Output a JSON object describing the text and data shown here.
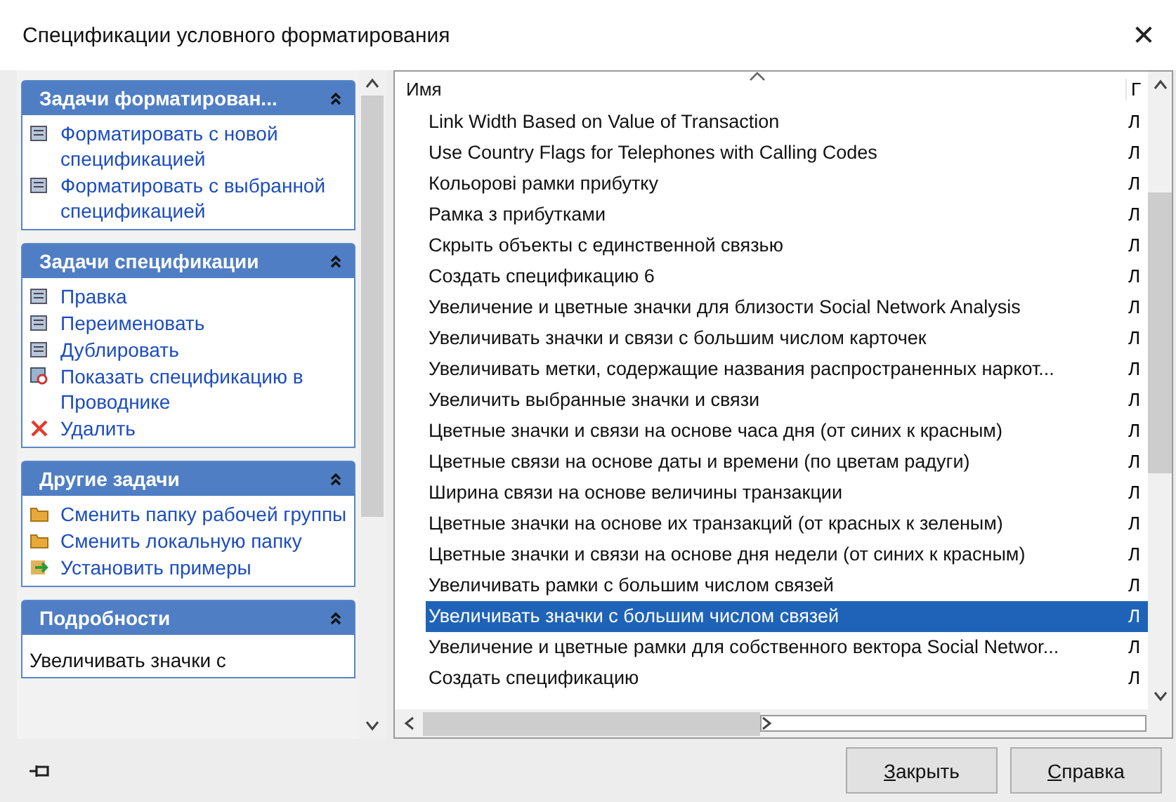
{
  "window": {
    "title": "Спецификации условного форматирования",
    "close": "✕"
  },
  "task_panes": [
    {
      "title": "Задачи форматирован...",
      "expanded": true,
      "items": [
        {
          "label": "Форматировать с новой спецификацией"
        },
        {
          "label": "Форматировать с выбранной спецификацией"
        }
      ]
    },
    {
      "title": "Задачи спецификации",
      "expanded": true,
      "items": [
        {
          "label": "Правка"
        },
        {
          "label": "Переименовать"
        },
        {
          "label": "Дублировать"
        },
        {
          "label": "Показать спецификацию в Проводнике"
        },
        {
          "label": "Удалить"
        }
      ]
    },
    {
      "title": "Другие задачи",
      "expanded": true,
      "items": [
        {
          "label": "Сменить папку рабочей группы"
        },
        {
          "label": "Сменить локальную папку"
        },
        {
          "label": "Установить примеры"
        }
      ]
    },
    {
      "title": "Подробности",
      "expanded": true,
      "text": "Увеличивать значки с"
    }
  ],
  "table": {
    "columns": [
      "Имя",
      "Г"
    ],
    "rows": [
      {
        "name": "Link Width Based on Value of Transaction",
        "column_2": "Л",
        "selected": false
      },
      {
        "name": "Use Country Flags for Telephones with Calling Codes",
        "column_2": "Л",
        "selected": false
      },
      {
        "name": "Кольорові рамки прибутку",
        "column_2": "Л",
        "selected": false
      },
      {
        "name": "Рамка з прибутками",
        "column_2": "Л",
        "selected": false
      },
      {
        "name": "Скрыть объекты с единственной связью",
        "column_2": "Л",
        "selected": false
      },
      {
        "name": "Создать спецификацию 6",
        "column_2": "Л",
        "selected": false
      },
      {
        "name": "Увеличение и цветные значки для близости Social Network Analysis",
        "column_2": "Л",
        "selected": false
      },
      {
        "name": "Увеличивать значки и связи с большим числом карточек",
        "column_2": "Л",
        "selected": false
      },
      {
        "name": "Увеличивать метки, содержащие названия распространенных наркот...",
        "column_2": "Л",
        "selected": false
      },
      {
        "name": "Увеличить выбранные значки и связи",
        "column_2": "Л",
        "selected": false
      },
      {
        "name": "Цветные значки и связи на основе часа дня (от синих к красным)",
        "column_2": "Л",
        "selected": false
      },
      {
        "name": "Цветные связи на основе даты и времени (по цветам радуги)",
        "column_2": "Л",
        "selected": false
      },
      {
        "name": "Ширина связи на основе величины транзакции",
        "column_2": "Л",
        "selected": false
      },
      {
        "name": "Цветные значки на основе их транзакций (от красных к зеленым)",
        "column_2": "Л",
        "selected": false
      },
      {
        "name": "Цветные значки и связи на основе дня недели (от синих к красным)",
        "column_2": "Л",
        "selected": false
      },
      {
        "name": "Увеличивать рамки с большим числом связей",
        "column_2": "Л",
        "selected": false
      },
      {
        "name": "Увеличивать значки с большим числом связей",
        "column_2": "Л",
        "selected": true
      },
      {
        "name": "Увеличение и цветные рамки для собственного вектора Social Networ...",
        "column_2": "Л",
        "selected": false
      },
      {
        "name": "Создать спецификацию",
        "column_2": "Л",
        "selected": false
      }
    ]
  },
  "buttons": [
    "Закрыть",
    "Справка"
  ]
}
